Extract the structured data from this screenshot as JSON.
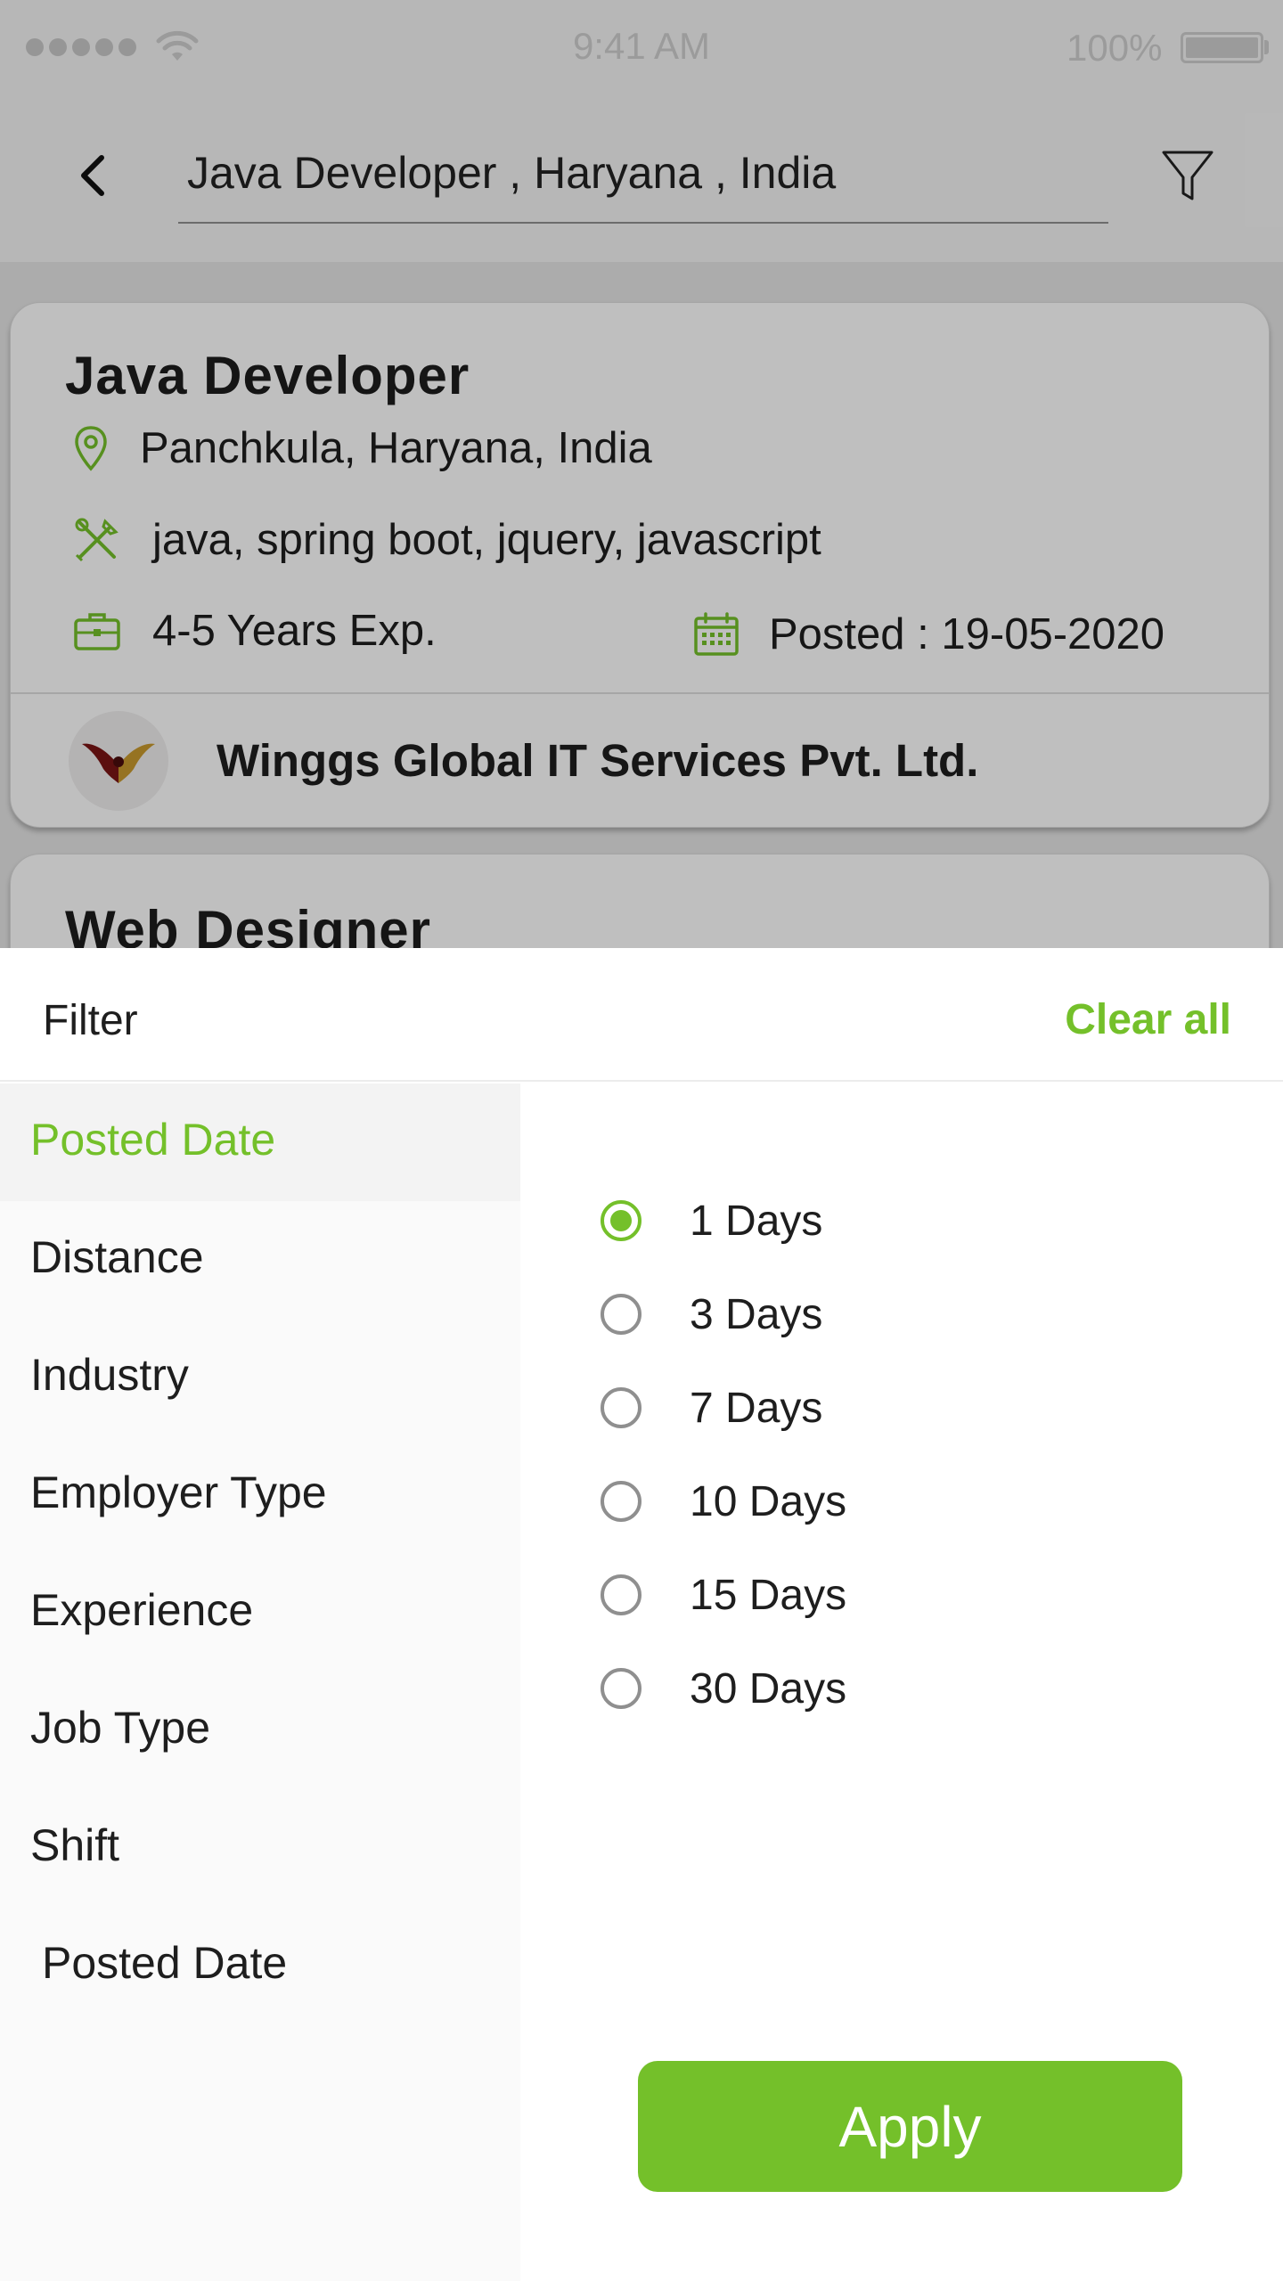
{
  "status_bar": {
    "time": "9:41 AM",
    "battery": "100%"
  },
  "search": {
    "query": "Java Developer , Haryana , India"
  },
  "jobs": [
    {
      "title": "Java  Developer",
      "location": "Panchkula, Haryana, India",
      "skills": "java, spring boot, jquery, javascript",
      "experience": "4-5 Years Exp.",
      "posted": "Posted : 19-05-2020",
      "company": "Winggs Global IT Services Pvt. Ltd."
    },
    {
      "title": "Web Designer"
    }
  ],
  "filter": {
    "title": "Filter",
    "clear_all": "Clear all",
    "categories": [
      {
        "label": "Posted Date",
        "active": true
      },
      {
        "label": "Distance"
      },
      {
        "label": "Industry"
      },
      {
        "label": "Employer Type"
      },
      {
        "label": "Experience"
      },
      {
        "label": "Job Type"
      },
      {
        "label": "Shift"
      },
      {
        "label": "Posted Date"
      }
    ],
    "options": [
      {
        "label": "1 Days",
        "selected": true
      },
      {
        "label": "3 Days",
        "selected": false
      },
      {
        "label": "7 Days",
        "selected": false
      },
      {
        "label": "10 Days",
        "selected": false
      },
      {
        "label": "15 Days",
        "selected": false
      },
      {
        "label": "30 Days",
        "selected": false
      }
    ],
    "apply": "Apply"
  },
  "colors": {
    "accent": "#74c02a",
    "text": "#1e1e1e"
  },
  "icons": [
    "back-arrow-icon",
    "filter-funnel-icon",
    "location-pin-icon",
    "tools-icon",
    "briefcase-icon",
    "calendar-icon",
    "wifi-icon",
    "battery-icon"
  ]
}
